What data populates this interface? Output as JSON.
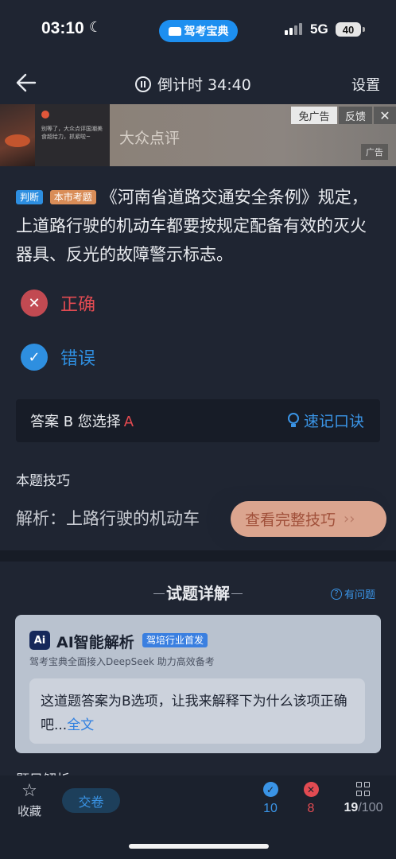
{
  "status_bar": {
    "time": "03:10",
    "brand": "驾考宝典",
    "network": "5G",
    "battery": "40"
  },
  "nav": {
    "timer_label": "倒计时 34:40",
    "settings_label": "设置"
  },
  "ad": {
    "title": "大众点评",
    "no_ad_label": "免广告",
    "feedback_label": "反馈",
    "close_glyph": "✕",
    "ad_tag": "广告",
    "small_text": "别等了，大众点评国潮美食超给力，抓紧啦~"
  },
  "question": {
    "type_tag": "判断",
    "region_tag": "本市考题",
    "text": "《河南省道路交通安全条例》规定，上道路行驶的机动车都要按规定配备有效的灭火器具、反光的故障警示标志。"
  },
  "options": [
    {
      "label": "正确",
      "status": "wrong-selected",
      "color": "#e24b52"
    },
    {
      "label": "错误",
      "status": "correct",
      "color": "#2f8fe0"
    }
  ],
  "answer_bar": {
    "answer_text": "答案 B 您选择",
    "selected": "A",
    "tip_label": "速记口诀"
  },
  "skill": {
    "title": "本题技巧",
    "text": "解析：上路行驶的机动车",
    "button_label": "查看完整技巧",
    "button_chevron": "››"
  },
  "detail": {
    "title": "试题详解",
    "help_label": "有问题",
    "help_glyph": "?"
  },
  "ai": {
    "logo": "Ai",
    "title": "AI智能解析",
    "badge": "驾培行业首发",
    "subtitle": "驾考宝典全面接入DeepSeek 助力高效备考",
    "body": "这道题答案为B选项，让我来解释下为什么该项正确吧...",
    "full_link": "全文"
  },
  "peek_text": "题目解析",
  "bottom": {
    "favorite_label": "收藏",
    "submit_label": "交卷",
    "correct_count": "10",
    "wrong_count": "8",
    "progress_current": "19",
    "progress_total": "/100"
  }
}
